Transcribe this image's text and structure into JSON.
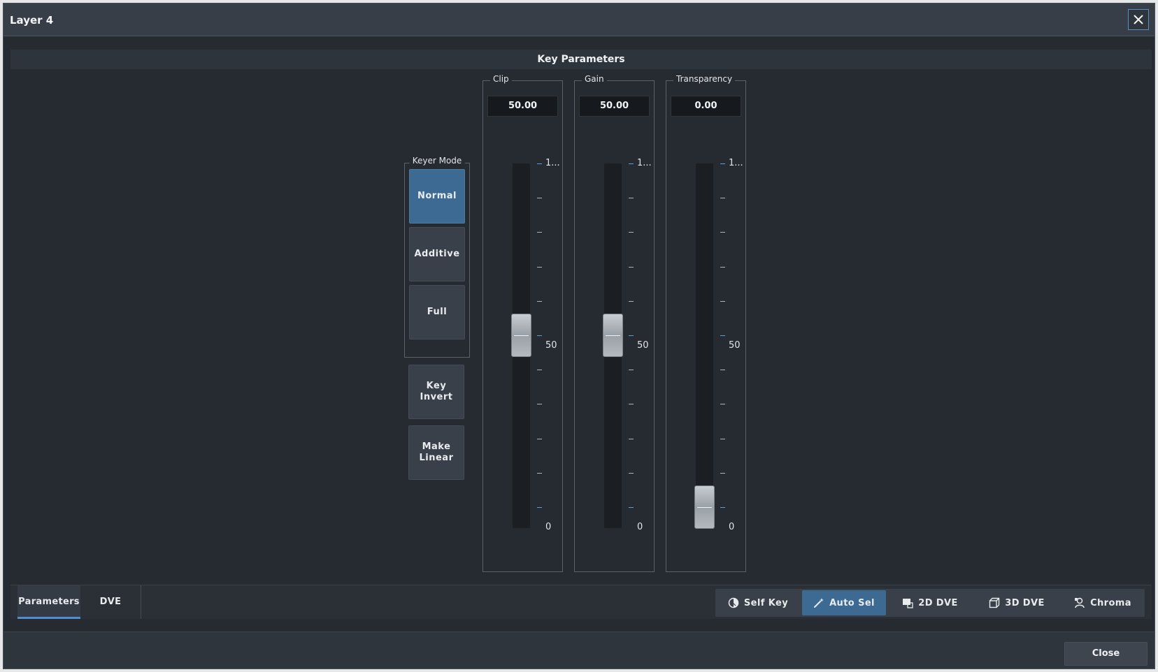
{
  "window": {
    "title": "Layer 4",
    "close_icon": "close-icon"
  },
  "section": {
    "title": "Key Parameters"
  },
  "keyer_mode": {
    "label": "Keyer Mode",
    "options": [
      "Normal",
      "Additive",
      "Full"
    ],
    "selected": "Normal"
  },
  "toggles": {
    "key_invert": "Key Invert",
    "make_linear": "Make Linear"
  },
  "faders": [
    {
      "label": "Clip",
      "value_text": "50.00",
      "value": 50,
      "min": 0,
      "max": 100,
      "tick_top": "1...",
      "tick_mid": "50",
      "tick_bottom": "0"
    },
    {
      "label": "Gain",
      "value_text": "50.00",
      "value": 50,
      "min": 0,
      "max": 100,
      "tick_top": "1...",
      "tick_mid": "50",
      "tick_bottom": "0"
    },
    {
      "label": "Transparency",
      "value_text": "0.00",
      "value": 0,
      "min": 0,
      "max": 100,
      "tick_top": "1...",
      "tick_mid": "50",
      "tick_bottom": "0"
    }
  ],
  "tabs": [
    {
      "label": "Parameters",
      "active": true
    },
    {
      "label": "DVE",
      "active": false
    }
  ],
  "modes": [
    {
      "label": "Self Key",
      "icon": "self-key-icon",
      "active": false
    },
    {
      "label": "Auto Sel",
      "icon": "wand-icon",
      "active": true
    },
    {
      "label": "2D DVE",
      "icon": "2d-dve-icon",
      "active": false
    },
    {
      "label": "3D DVE",
      "icon": "3d-dve-icon",
      "active": false
    },
    {
      "label": "Chroma",
      "icon": "chroma-icon",
      "active": false
    }
  ],
  "footer": {
    "close_label": "Close"
  },
  "colors": {
    "accent": "#3d6a93",
    "tab_indicator": "#4f8fcf",
    "background": "#262b31"
  }
}
